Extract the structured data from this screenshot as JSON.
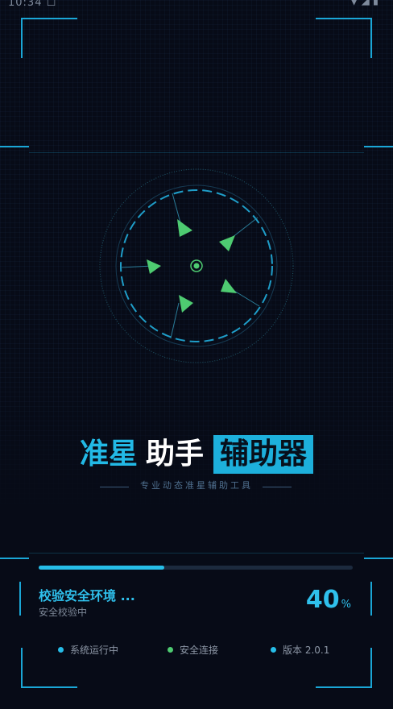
{
  "status_bar": {
    "time": "10:34 ☐",
    "right": "▼ ◢ ▮"
  },
  "title": {
    "part1": "准星",
    "part2": "助手",
    "part3": "辅助器"
  },
  "subtitle": "专业动态准星辅助工具",
  "progress": {
    "status_text": "校验安全环境 ...",
    "sub_text": "安全校验中",
    "value": 40,
    "percent_sign": "%"
  },
  "info": {
    "running": "系统运行中",
    "secure": "安全连接",
    "version": "版本 2.0.1"
  },
  "colors": {
    "accent": "#26bde8",
    "green": "#4ecb71",
    "background": "#070b17"
  }
}
